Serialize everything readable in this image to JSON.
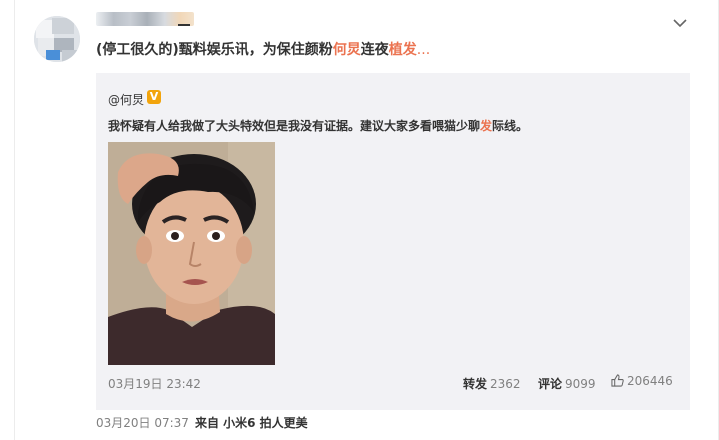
{
  "post": {
    "user_name_blurred": "",
    "text_prefix": "(停工很久的)甄料娱乐讯，为保住颜粉",
    "text_name": "何炅",
    "text_mid": "连夜",
    "text_highlight": "植发",
    "text_ellipsis": "..."
  },
  "repost": {
    "author": "@何炅",
    "badge": "V",
    "text_before": "我怀疑有人给我做了大头特效但是我没有证据。建议大家多看喂猫少聊",
    "text_highlight": "发",
    "text_after": "际线。",
    "time": "03月19日 23:42",
    "repost_label": "转发",
    "repost_count": "2362",
    "comment_label": "评论",
    "comment_count": "9099",
    "like_count": "206446"
  },
  "footer": {
    "time": "03月20日 07:37",
    "source": "来自 小米6 拍人更美"
  },
  "colors": {
    "accent_red": "#eb7350",
    "repost_bg": "#f2f2f5",
    "muted": "#808080"
  },
  "icons": {
    "expand": "chevron-down-icon",
    "like": "thumbs-up-icon",
    "verified": "verified-badge-icon"
  }
}
